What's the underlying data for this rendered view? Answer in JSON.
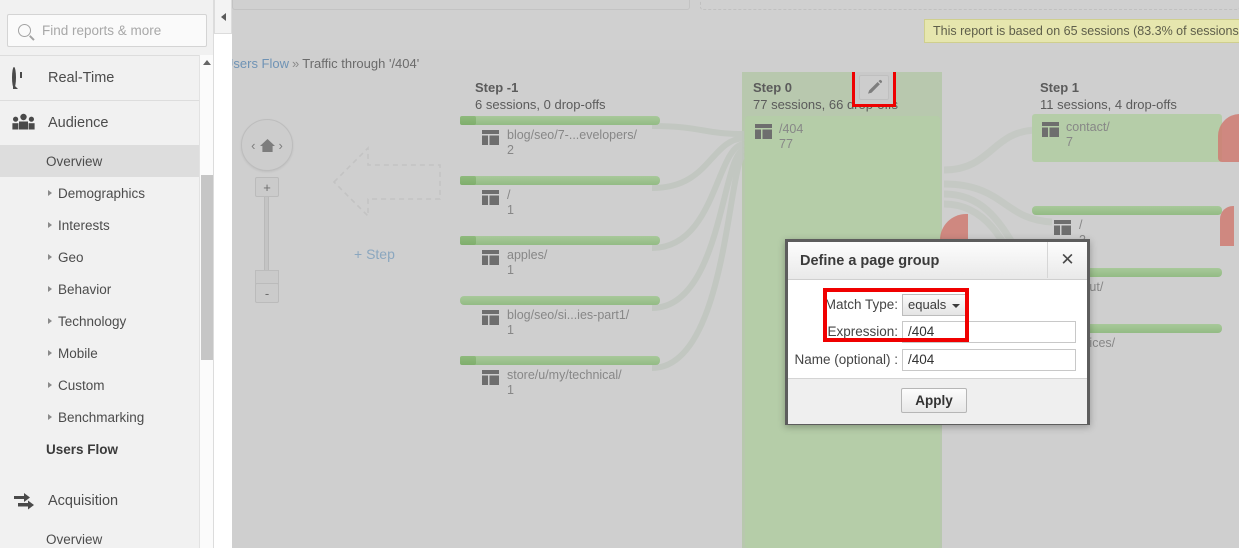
{
  "sidebar": {
    "search_placeholder": "Find reports & more",
    "groups": [
      {
        "label": "Real-Time",
        "icon": "clock-icon"
      },
      {
        "label": "Audience",
        "icon": "people-icon"
      },
      {
        "label": "Acquisition",
        "icon": "arrows-icon"
      }
    ],
    "audience_items": [
      {
        "label": "Overview",
        "expandable": false,
        "active": true,
        "bold": false
      },
      {
        "label": "Demographics",
        "expandable": true,
        "active": false,
        "bold": false
      },
      {
        "label": "Interests",
        "expandable": true,
        "active": false,
        "bold": false
      },
      {
        "label": "Geo",
        "expandable": true,
        "active": false,
        "bold": false
      },
      {
        "label": "Behavior",
        "expandable": true,
        "active": false,
        "bold": false
      },
      {
        "label": "Technology",
        "expandable": true,
        "active": false,
        "bold": false
      },
      {
        "label": "Mobile",
        "expandable": true,
        "active": false,
        "bold": false
      },
      {
        "label": "Custom",
        "expandable": true,
        "active": false,
        "bold": false
      },
      {
        "label": "Benchmarking",
        "expandable": true,
        "active": false,
        "bold": false
      },
      {
        "label": "Users Flow",
        "expandable": false,
        "active": false,
        "bold": true
      }
    ],
    "acquisition_items": [
      {
        "label": "Overview",
        "expandable": false,
        "active": false,
        "bold": false
      }
    ]
  },
  "header": {
    "banner": "This report is based on 65 sessions (83.3% of sessions",
    "breadcrumb_link": "Users Flow",
    "breadcrumb_sep": "»",
    "breadcrumb_current": "Traffic through '/404'"
  },
  "controls": {
    "home_label": "home-icon",
    "left_chevron": "‹",
    "right_chevron": "›",
    "zoom_in": "+",
    "zoom_out": "-",
    "add_step_label": "+ Step"
  },
  "flow": {
    "steps": [
      {
        "title": "Step -1",
        "stats": "6 sessions, 0 drop-offs"
      },
      {
        "title": "Step 0",
        "stats": "77 sessions, 66 drop-offs"
      },
      {
        "title": "Step 1",
        "stats": "11 sessions, 4 drop-offs"
      }
    ],
    "step_minus1_nodes": [
      {
        "name": "blog/seo/7-...evelopers/",
        "value": "2"
      },
      {
        "name": "/",
        "value": "1"
      },
      {
        "name": "apples/",
        "value": "1"
      },
      {
        "name": "blog/seo/si...ies-part1/",
        "value": "1"
      },
      {
        "name": "store/u/my/technical/",
        "value": "1"
      }
    ],
    "step0_nodes": [
      {
        "name": "/404",
        "value": "77"
      }
    ],
    "step1_nodes": [
      {
        "name": "contact/",
        "value": "7"
      },
      {
        "name": "/",
        "value": "2"
      },
      {
        "name": "...ut/",
        "value": ""
      },
      {
        "name": "...ices/",
        "value": ""
      }
    ]
  },
  "dialog": {
    "title": "Define a page group",
    "close": "✕",
    "match_label": "Match Type:",
    "match_value": "equals",
    "expression_label": "Expression:",
    "expression_value": "/404",
    "name_label": "Name (optional) :",
    "name_value": "/404",
    "apply_label": "Apply"
  },
  "colors": {
    "green_node": "#b3cba6",
    "green_bar": "#93bb84",
    "dropoff_red": "#cf7b72",
    "highlight_red": "#f00000",
    "banner_bg": "#e6e6ae",
    "link_blue": "#6f93b5"
  }
}
